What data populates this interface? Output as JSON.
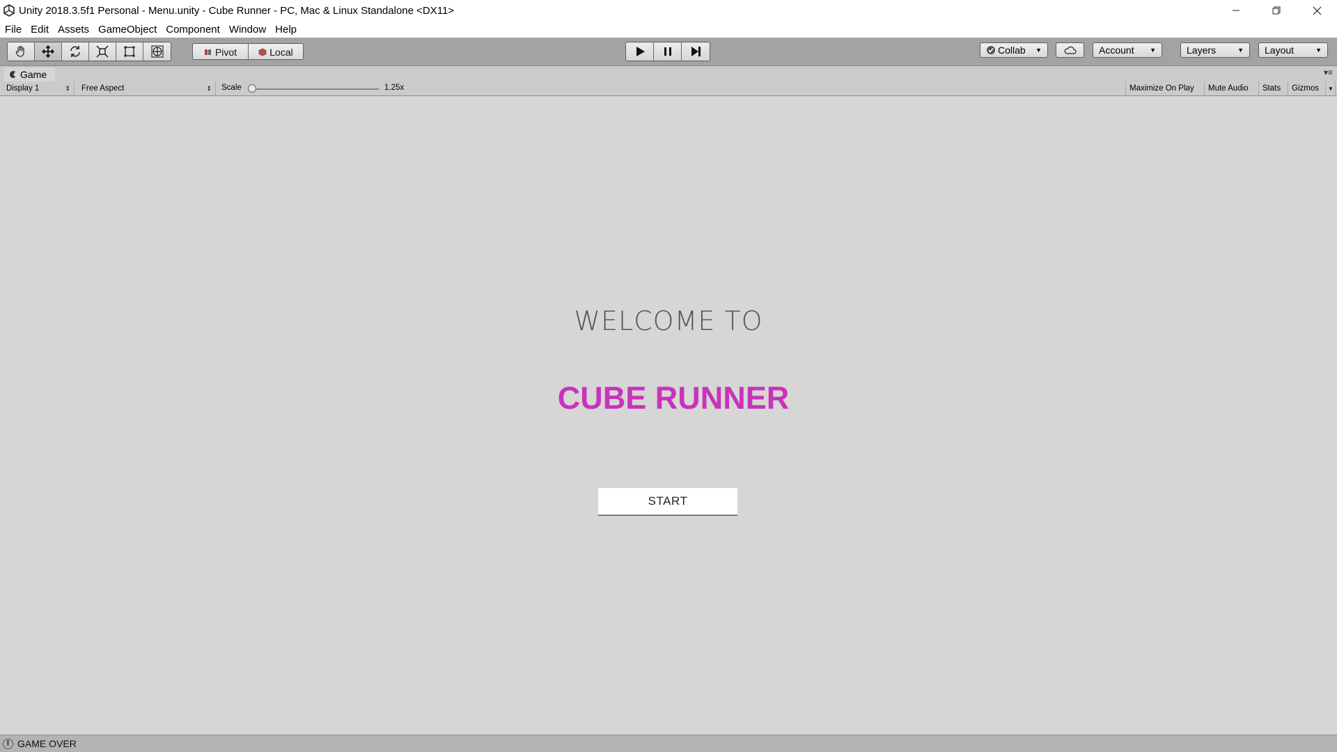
{
  "window": {
    "title": "Unity 2018.3.5f1 Personal - Menu.unity - Cube Runner - PC, Mac & Linux Standalone <DX11>",
    "icon": "unity-logo-icon"
  },
  "menu": [
    "File",
    "Edit",
    "Assets",
    "GameObject",
    "Component",
    "Window",
    "Help"
  ],
  "toolbar": {
    "tools": [
      "hand-tool-icon",
      "move-tool-icon",
      "rotate-tool-icon",
      "scale-tool-icon",
      "rect-tool-icon",
      "transform-tool-icon"
    ],
    "active_tool": "move-tool-icon",
    "pivot_label": "Pivot",
    "local_label": "Local",
    "collab_label": "Collab",
    "account_label": "Account",
    "layers_label": "Layers",
    "layout_label": "Layout"
  },
  "game_panel": {
    "tab_label": "Game",
    "display_label": "Display 1",
    "aspect_label": "Free Aspect",
    "scale_label": "Scale",
    "scale_value": "1.25x",
    "scale_fraction": 0.0,
    "maximize_label": "Maximize On Play",
    "mute_label": "Mute Audio",
    "stats_label": "Stats",
    "gizmos_label": "Gizmos"
  },
  "game_view": {
    "welcome_text": "WELCOME TO",
    "title_text": "CUBE RUNNER",
    "title_color": "#c933ba",
    "start_label": "START"
  },
  "status": {
    "text": "GAME OVER"
  }
}
